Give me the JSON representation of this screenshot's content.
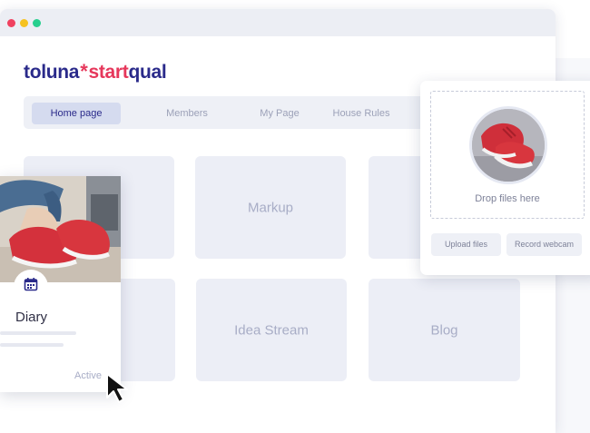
{
  "logo": {
    "part1": "toluna",
    "star": "*",
    "part2": "start",
    "part3": "qual"
  },
  "nav": {
    "tabs": [
      {
        "label": "Home page",
        "active": true
      },
      {
        "label": "Members",
        "active": false
      },
      {
        "label": "My Page",
        "active": false
      },
      {
        "label": "House Rules",
        "active": false
      }
    ]
  },
  "cards": {
    "markup": "Markup",
    "idea_stream": "Idea Stream",
    "blog": "Blog"
  },
  "upload_panel": {
    "drop_text": "Drop files here",
    "upload_button": "Upload files",
    "webcam_button": "Record webcam"
  },
  "diary_card": {
    "title": "Diary",
    "status": "Active",
    "icon": "calendar-icon"
  },
  "colors": {
    "brand_navy": "#2a2a8a",
    "brand_pink": "#e6375b",
    "shoe_red": "#d8363e",
    "card_bg": "#eceef6"
  }
}
